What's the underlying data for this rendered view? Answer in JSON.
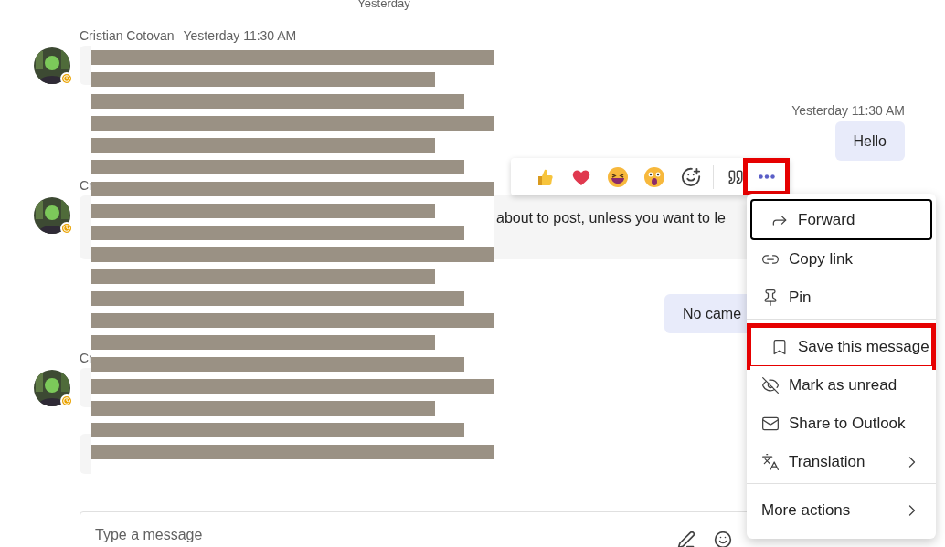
{
  "date_divider": "Yesterday",
  "messages": [
    {
      "kind": "incoming",
      "author": "Cristian Cotovan",
      "time": "Yesterday 11:30 AM",
      "away": true
    },
    {
      "kind": "outgoing",
      "time": "Yesterday 11:30 AM",
      "text": "Hello"
    },
    {
      "kind": "incoming",
      "author": "Cr",
      "away": true,
      "text": "about to post, unless you want to le"
    },
    {
      "kind": "outgoing",
      "text": "No came"
    },
    {
      "kind": "incoming",
      "author": "Cr",
      "away": true
    },
    {
      "kind": "continuation"
    }
  ],
  "reaction_bar": {
    "more_highlighted": true
  },
  "menu": {
    "groups": [
      [
        {
          "label": "Forward",
          "focused": true,
          "highlighted": false,
          "submenu": false
        },
        {
          "label": "Copy link",
          "focused": false,
          "highlighted": false,
          "submenu": false
        },
        {
          "label": "Pin",
          "focused": false,
          "highlighted": false,
          "submenu": false
        }
      ],
      [
        {
          "label": "Save this message",
          "focused": false,
          "highlighted": true,
          "submenu": false
        },
        {
          "label": "Mark as unread",
          "focused": false,
          "highlighted": false,
          "submenu": false
        },
        {
          "label": "Share to Outlook",
          "focused": false,
          "highlighted": false,
          "submenu": false
        },
        {
          "label": "Translation",
          "focused": false,
          "highlighted": false,
          "submenu": true
        }
      ],
      [
        {
          "label": "More actions",
          "focused": false,
          "highlighted": false,
          "submenu": true
        }
      ]
    ]
  },
  "compose": {
    "placeholder": "Type a message"
  }
}
